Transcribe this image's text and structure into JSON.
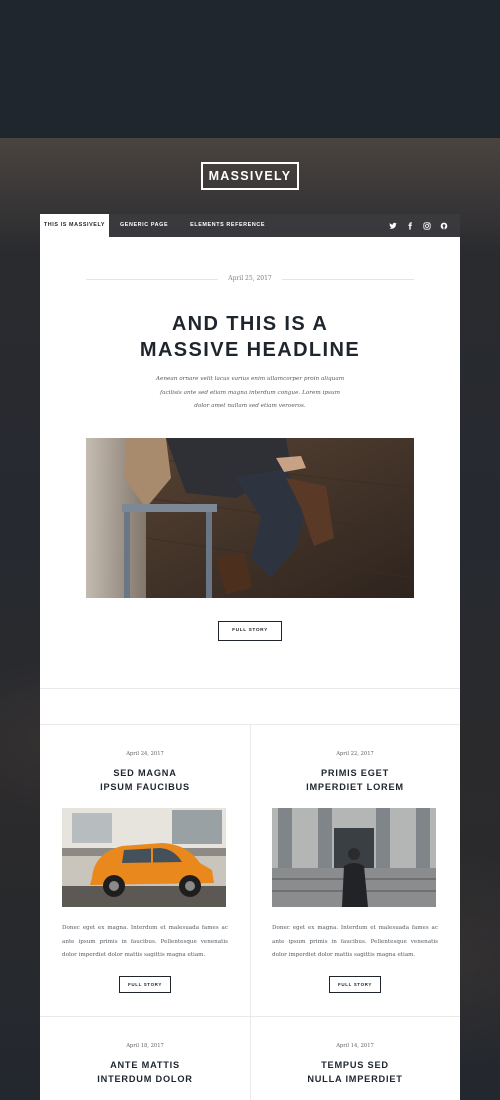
{
  "site": {
    "logo": "MASSIVELY"
  },
  "nav": {
    "links": [
      {
        "label": "This is Massively",
        "active": true
      },
      {
        "label": "Generic Page",
        "active": false
      },
      {
        "label": "Elements Reference",
        "active": false
      }
    ],
    "social_icons": [
      "twitter-icon",
      "facebook-icon",
      "instagram-icon",
      "github-icon"
    ]
  },
  "featured": {
    "date": "April 25, 2017",
    "headline_line1": "AND THIS IS A",
    "headline_line2": "MASSIVE HEADLINE",
    "intro": "Aenean ornare velit lacus varius enim ullamcorper proin aliquam facilisis ante sed etiam magna interdum congue. Lorem ipsum dolor amet nullam sed etiam veroeros.",
    "button_label": "Full Story"
  },
  "posts": [
    {
      "date": "April 24, 2017",
      "title_line1": "SED MAGNA",
      "title_line2": "IPSUM FAUCIBUS",
      "text": "Donec eget ex magna. Interdum et malesuada fames ac ante ipsum primis in faucibus. Pellentesque venenatis dolor imperdiet dolor mattis sagittis magna etiam.",
      "button_label": "Full Story"
    },
    {
      "date": "April 22, 2017",
      "title_line1": "PRIMIS EGET",
      "title_line2": "IMPERDIET LOREM",
      "text": "Donec eget ex magna. Interdum et malesuada fames ac ante ipsum primis in faucibus. Pellentesque venenatis dolor imperdiet dolor mattis sagittis magna etiam.",
      "button_label": "Full Story"
    },
    {
      "date": "April 18, 2017",
      "title_line1": "ANTE MATTIS",
      "title_line2": "INTERDUM DOLOR"
    },
    {
      "date": "April 14, 2017",
      "title_line1": "TEMPUS SED",
      "title_line2": "NULLA IMPERDIET"
    }
  ],
  "colors": {
    "page_background": "#1f262e",
    "card_background": "#ffffff",
    "heading": "#1e252d",
    "nav_bar": "#3c3c40",
    "car_orange": "#e8881d"
  }
}
